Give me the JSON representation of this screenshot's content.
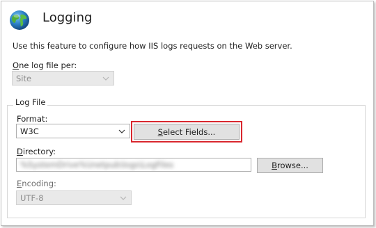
{
  "header": {
    "title": "Logging",
    "icon": "globe-icon"
  },
  "description": "Use this feature to configure how IIS logs requests on the Web server.",
  "one_log_file_per": {
    "label_mnemonic": "O",
    "label_rest": "ne log file per:",
    "selected": "Site",
    "disabled": true
  },
  "log_file_group": {
    "legend": "Log File",
    "format": {
      "label": "Format:",
      "selected": "W3C"
    },
    "select_fields_button": {
      "mnemonic": "S",
      "rest": "elect Fields..."
    },
    "directory": {
      "label_mnemonic": "D",
      "label_rest": "irectory:",
      "value": "%SystemDrive%\\inetpub\\logs\\LogFiles"
    },
    "browse_button": {
      "mnemonic": "B",
      "rest": "rowse..."
    },
    "encoding": {
      "label_mnemonic": "E",
      "label_rest": "ncoding:",
      "selected": "UTF-8",
      "disabled": true
    }
  },
  "colors": {
    "highlight_border": "#d9272e",
    "button_face": "#e1e1e1",
    "disabled_field": "#e9e9e9"
  }
}
